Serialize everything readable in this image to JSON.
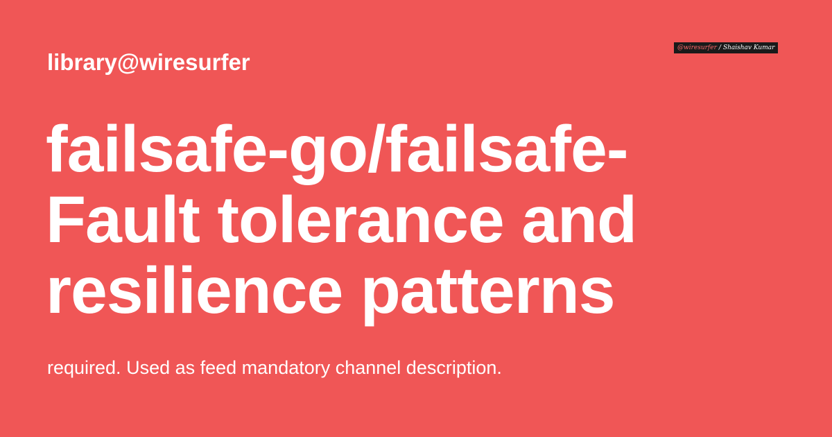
{
  "site": {
    "label": "library@wiresurfer"
  },
  "badge": {
    "handle": "@wiresurfer",
    "separator": "/",
    "author": "Shaishav Kumar"
  },
  "headline": {
    "lines": [
      "failsafe-go/failsafe-",
      "Fault tolerance and",
      "resilience patterns"
    ]
  },
  "description": {
    "text": "required. Used as feed mandatory channel description."
  },
  "colors": {
    "background": "#f05656",
    "text": "#ffffff",
    "badge_background": "#1a1a1a",
    "badge_handle": "#ff6b6b"
  }
}
